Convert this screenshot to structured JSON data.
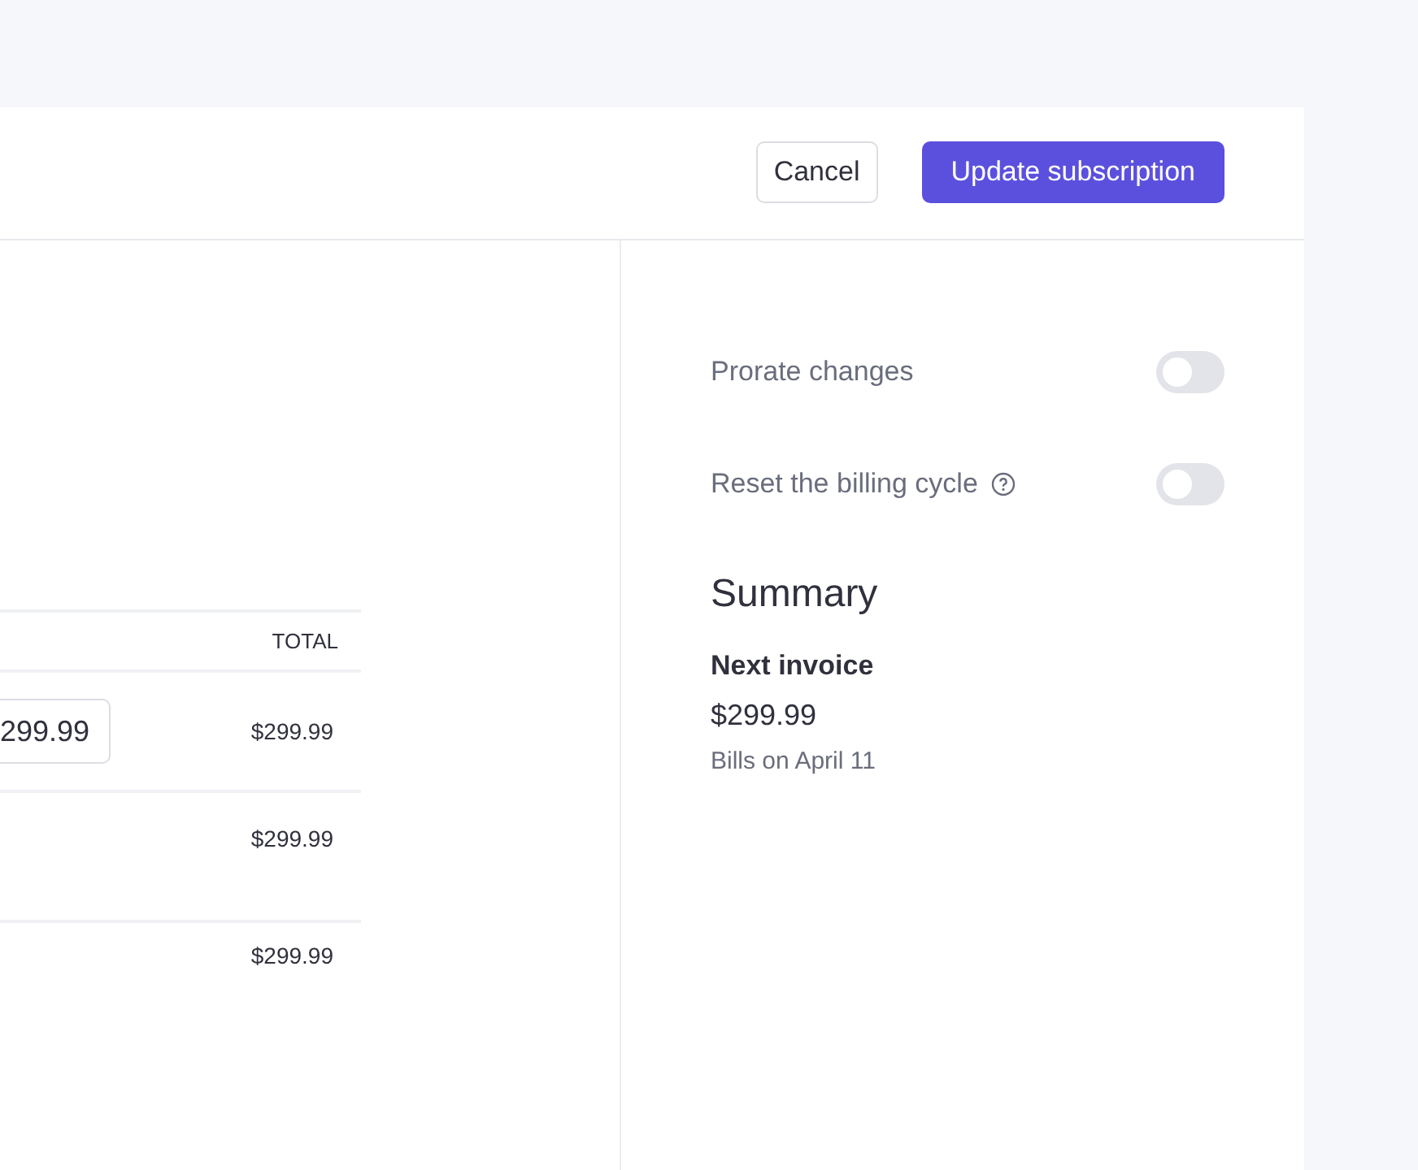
{
  "header": {
    "buttons": [
      {
        "label": "Cancel",
        "kind": "secondary"
      },
      {
        "label": "Update subscription",
        "kind": "primary"
      }
    ]
  },
  "table": {
    "columns": [
      "TOTAL"
    ],
    "rows": [
      {
        "price_input": "299.99",
        "total": "$299.99"
      },
      {
        "total": "$299.99"
      },
      {
        "total": "$299.99"
      }
    ]
  },
  "settings": [
    {
      "label": "Prorate changes",
      "on": false,
      "help": false
    },
    {
      "label": "Reset the billing cycle",
      "on": false,
      "help": true
    }
  ],
  "summary": {
    "title": "Summary",
    "next_invoice_label": "Next invoice",
    "amount": "$299.99",
    "bills_on": "Bills on April 11"
  }
}
